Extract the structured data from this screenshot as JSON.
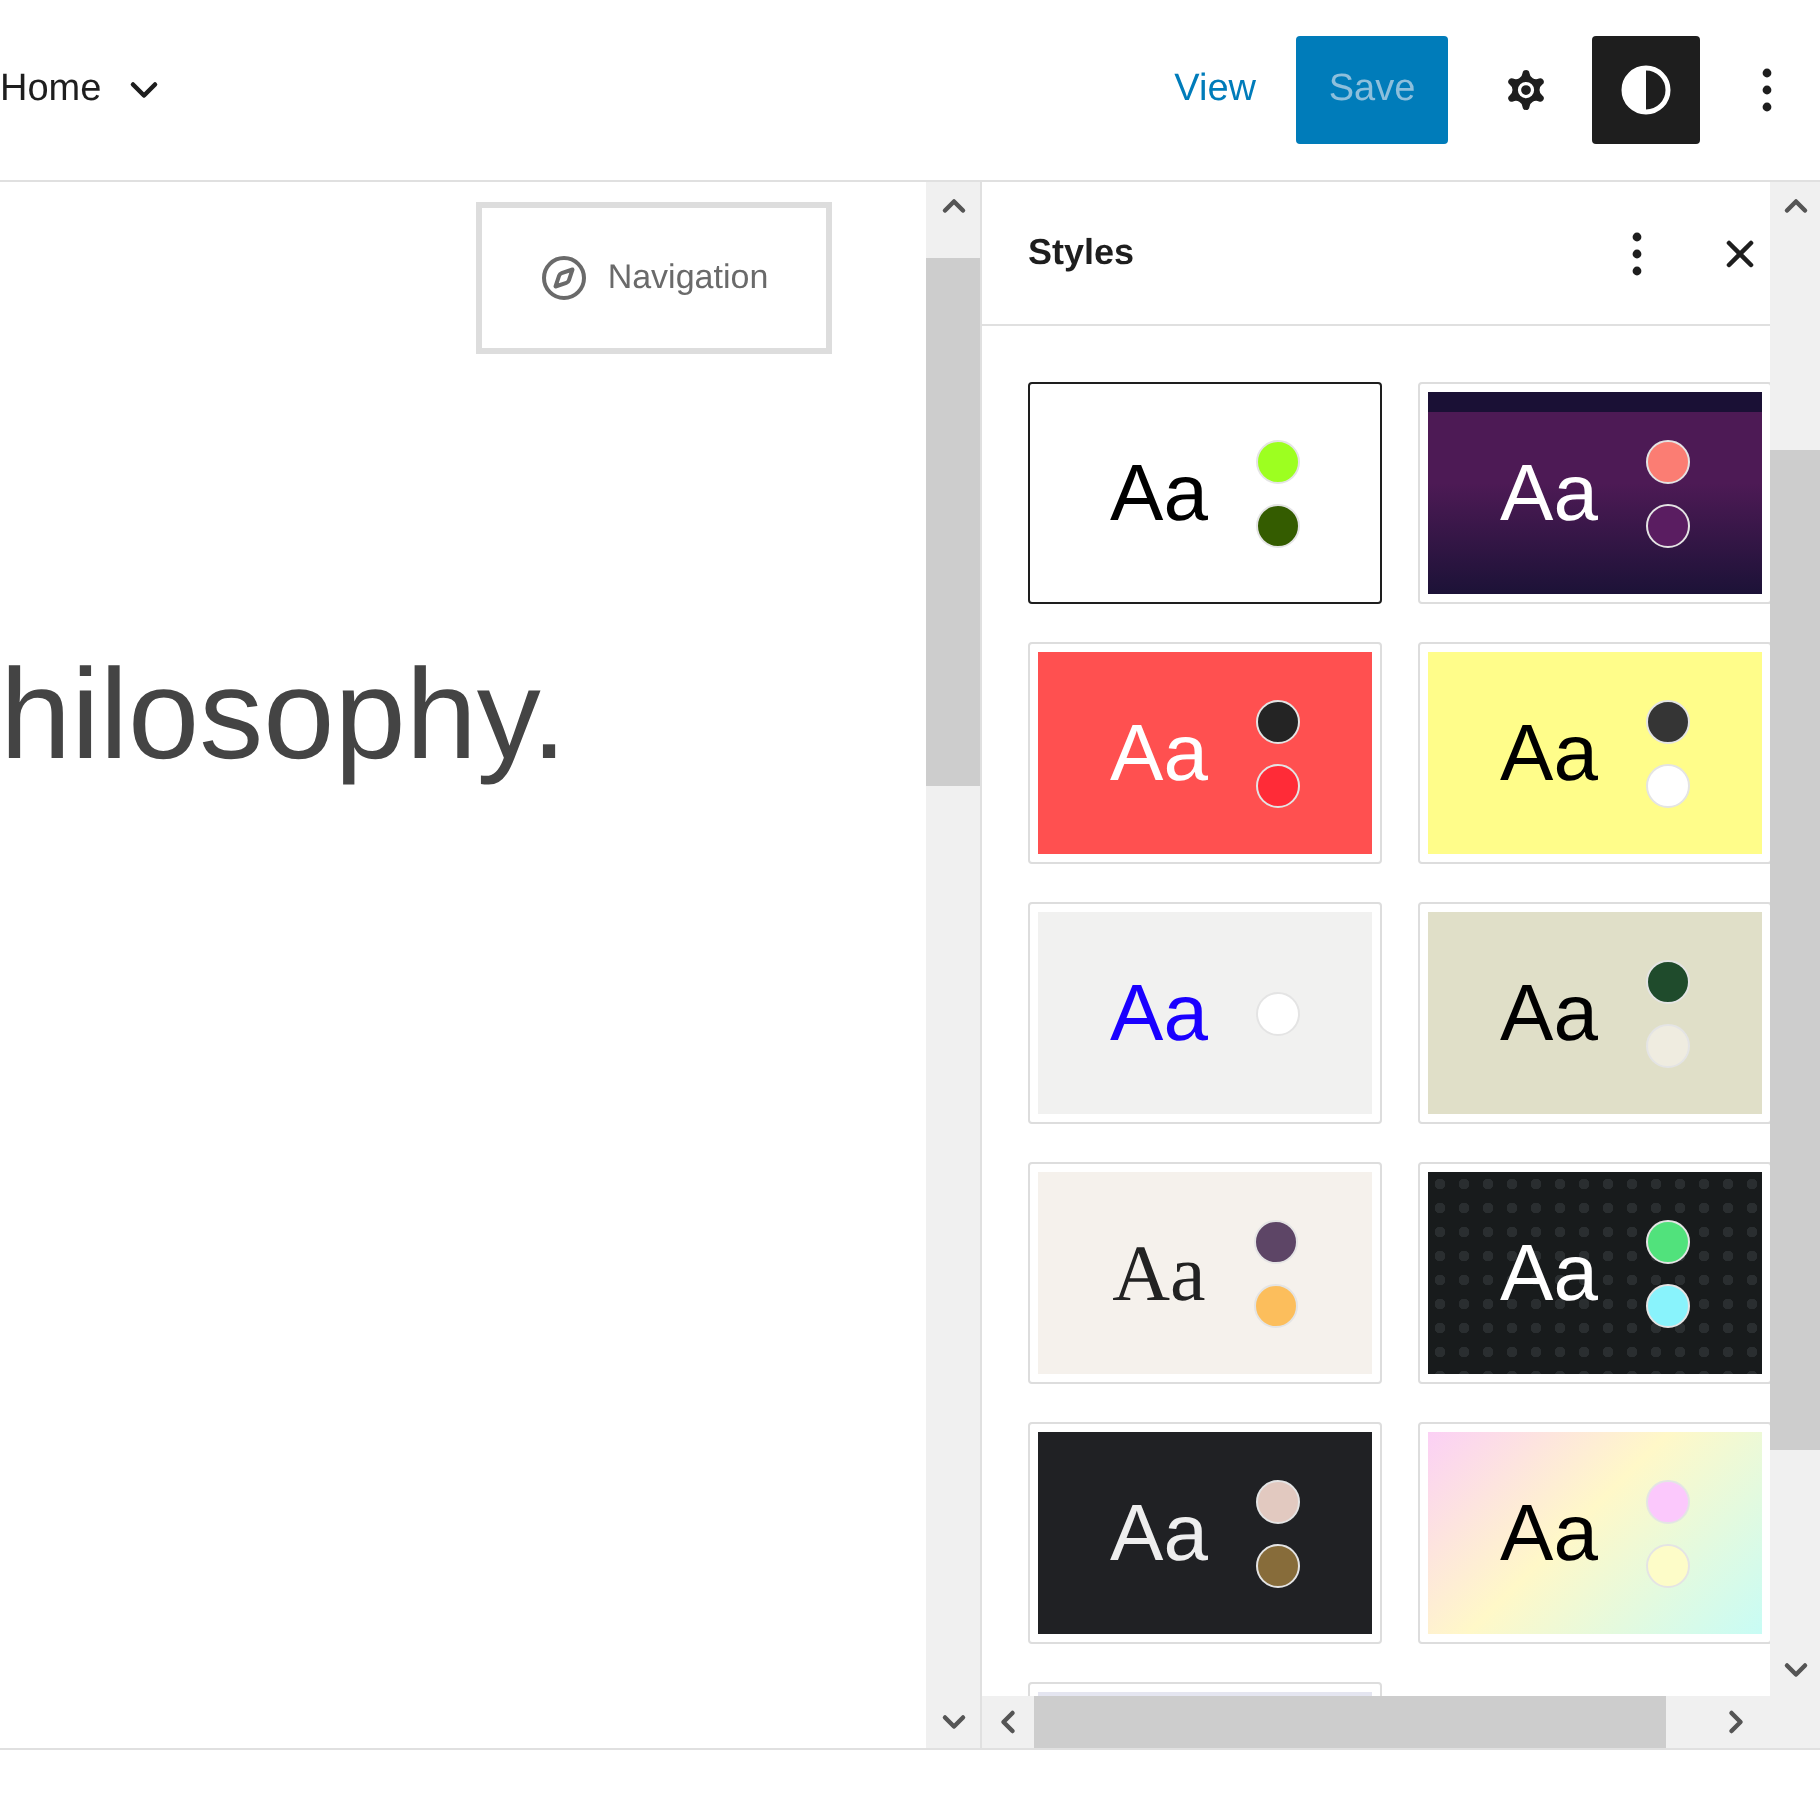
{
  "header": {
    "page": "Home",
    "view_link": "View",
    "save": {
      "label": "Save",
      "disabled": true
    },
    "styles_button": {
      "selected": true
    }
  },
  "canvas": {
    "navigation": "Navigation",
    "heading": "hilosophy."
  },
  "sidebar": {
    "title": "Styles",
    "variations": [
      {
        "label": {
          "text": "Aa",
          "color": "#000000"
        },
        "kind": "plain",
        "selected": true,
        "color": "#ffffff",
        "serif": false,
        "dots": [
          {
            "color": "#9dff20"
          },
          {
            "color": "#345c00"
          }
        ]
      },
      {
        "label": {
          "text": "Aa",
          "color": "#ffffff"
        },
        "kind": "banded",
        "selected": false,
        "color": "#4d1a55",
        "serif": false,
        "dots": [
          {
            "color": "#fb7d73"
          },
          {
            "color": "#5a1d61"
          }
        ]
      },
      {
        "label": {
          "text": "Aa",
          "color": "#ffffff"
        },
        "kind": "plain",
        "selected": false,
        "color": "#ff5050",
        "serif": false,
        "dots": [
          {
            "color": "#242424"
          },
          {
            "color": "#ff2b37"
          }
        ]
      },
      {
        "label": {
          "text": "Aa",
          "color": "#000000"
        },
        "kind": "plain",
        "selected": false,
        "color": "#fffd8a",
        "serif": false,
        "dots": [
          {
            "color": "#353535"
          },
          {
            "color": "#ffffff"
          }
        ]
      },
      {
        "label": {
          "text": "Aa",
          "color": "#1a00ff"
        },
        "kind": "plain",
        "selected": false,
        "color": "#f1f1f0",
        "serif": false,
        "dots": [
          {
            "color": "#ffffff"
          }
        ]
      },
      {
        "label": {
          "text": "Aa",
          "color": "#000000"
        },
        "kind": "plain",
        "selected": false,
        "color": "#e0dfc8",
        "serif": false,
        "dots": [
          {
            "color": "#1f4b2c"
          },
          {
            "color": "#efece0"
          }
        ]
      },
      {
        "label": {
          "text": "Aa",
          "color": "#222222"
        },
        "kind": "plain",
        "selected": false,
        "color": "#f5f1ec",
        "serif": true,
        "dots": [
          {
            "color": "#5d4566"
          },
          {
            "color": "#fcbe5c"
          }
        ]
      },
      {
        "label": {
          "text": "Aa",
          "color": "#ffffff"
        },
        "kind": "pattern",
        "selected": false,
        "color": "#181b1c",
        "serif": false,
        "dots": [
          {
            "color": "#51e27c"
          },
          {
            "color": "#89f3fc"
          }
        ]
      },
      {
        "label": {
          "text": "Aa",
          "color": "#eeeeee"
        },
        "kind": "plain",
        "selected": false,
        "color": "#202124",
        "serif": false,
        "dots": [
          {
            "color": "#e2c9c0"
          },
          {
            "color": "#876c3a"
          }
        ]
      },
      {
        "label": {
          "text": "Aa",
          "color": "#000000"
        },
        "kind": "gradient",
        "selected": false,
        "color": "#fff8c8",
        "serif": false,
        "dots": [
          {
            "color": "#fbc8fc"
          },
          {
            "color": "#fdfcc8"
          }
        ]
      },
      {
        "kind": "plain",
        "selected": false,
        "color": "#e4e5f0"
      }
    ]
  }
}
